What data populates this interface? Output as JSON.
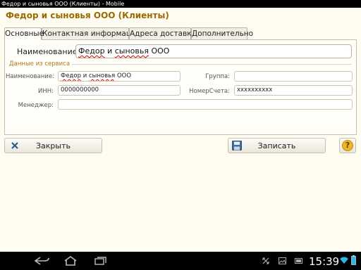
{
  "window": {
    "title": "Федор и сыновья ООО (Клиенты) - Mobile"
  },
  "form": {
    "title": "Федор и сыновья ООО (Клиенты)"
  },
  "tabs": [
    {
      "label": "Основные"
    },
    {
      "label": "Контактная информация"
    },
    {
      "label": "Адреса доставки"
    },
    {
      "label": "Дополнительно"
    }
  ],
  "main": {
    "name_label": "Наименование:",
    "name_word1": "Федор",
    "name_word2": "и",
    "name_word3": "сыновья",
    "name_word4": "ООО"
  },
  "service": {
    "group_title": "Данные из сервиса",
    "name_label": "Наименование:",
    "name_word1": "Федор",
    "name_word2": "и",
    "name_word3": "сыновья",
    "name_word4": "ООО",
    "inn_label": "ИНН:",
    "inn_value": "0000000000",
    "manager_label": "Менеджер:",
    "manager_value": "",
    "group_label": "Группа:",
    "group_value": "",
    "account_label": "НомерСчета:",
    "account_value": "xxxxxxxxxx"
  },
  "buttons": {
    "close_label": "Закрыть",
    "save_label": "Записать",
    "help_label": "?"
  },
  "status_bar": {
    "time": "15:39"
  },
  "colors": {
    "accent": "#9b6a00",
    "background": "#fffdf2"
  }
}
